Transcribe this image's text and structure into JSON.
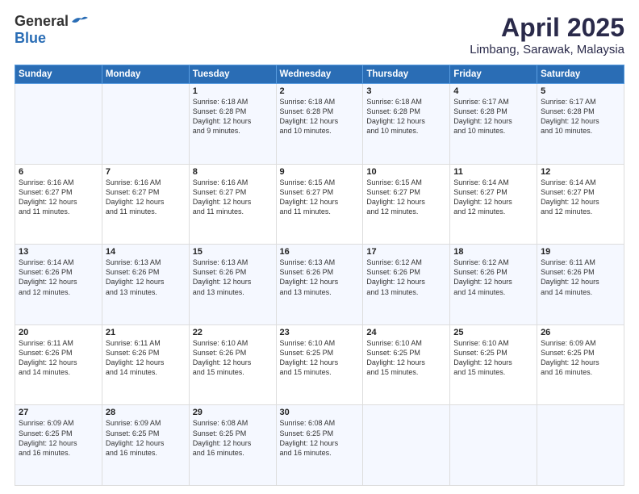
{
  "header": {
    "logo_general": "General",
    "logo_blue": "Blue",
    "month_title": "April 2025",
    "location": "Limbang, Sarawak, Malaysia"
  },
  "weekdays": [
    "Sunday",
    "Monday",
    "Tuesday",
    "Wednesday",
    "Thursday",
    "Friday",
    "Saturday"
  ],
  "weeks": [
    [
      {
        "day": "",
        "info": ""
      },
      {
        "day": "",
        "info": ""
      },
      {
        "day": "1",
        "info": "Sunrise: 6:18 AM\nSunset: 6:28 PM\nDaylight: 12 hours\nand 9 minutes."
      },
      {
        "day": "2",
        "info": "Sunrise: 6:18 AM\nSunset: 6:28 PM\nDaylight: 12 hours\nand 10 minutes."
      },
      {
        "day": "3",
        "info": "Sunrise: 6:18 AM\nSunset: 6:28 PM\nDaylight: 12 hours\nand 10 minutes."
      },
      {
        "day": "4",
        "info": "Sunrise: 6:17 AM\nSunset: 6:28 PM\nDaylight: 12 hours\nand 10 minutes."
      },
      {
        "day": "5",
        "info": "Sunrise: 6:17 AM\nSunset: 6:28 PM\nDaylight: 12 hours\nand 10 minutes."
      }
    ],
    [
      {
        "day": "6",
        "info": "Sunrise: 6:16 AM\nSunset: 6:27 PM\nDaylight: 12 hours\nand 11 minutes."
      },
      {
        "day": "7",
        "info": "Sunrise: 6:16 AM\nSunset: 6:27 PM\nDaylight: 12 hours\nand 11 minutes."
      },
      {
        "day": "8",
        "info": "Sunrise: 6:16 AM\nSunset: 6:27 PM\nDaylight: 12 hours\nand 11 minutes."
      },
      {
        "day": "9",
        "info": "Sunrise: 6:15 AM\nSunset: 6:27 PM\nDaylight: 12 hours\nand 11 minutes."
      },
      {
        "day": "10",
        "info": "Sunrise: 6:15 AM\nSunset: 6:27 PM\nDaylight: 12 hours\nand 12 minutes."
      },
      {
        "day": "11",
        "info": "Sunrise: 6:14 AM\nSunset: 6:27 PM\nDaylight: 12 hours\nand 12 minutes."
      },
      {
        "day": "12",
        "info": "Sunrise: 6:14 AM\nSunset: 6:27 PM\nDaylight: 12 hours\nand 12 minutes."
      }
    ],
    [
      {
        "day": "13",
        "info": "Sunrise: 6:14 AM\nSunset: 6:26 PM\nDaylight: 12 hours\nand 12 minutes."
      },
      {
        "day": "14",
        "info": "Sunrise: 6:13 AM\nSunset: 6:26 PM\nDaylight: 12 hours\nand 13 minutes."
      },
      {
        "day": "15",
        "info": "Sunrise: 6:13 AM\nSunset: 6:26 PM\nDaylight: 12 hours\nand 13 minutes."
      },
      {
        "day": "16",
        "info": "Sunrise: 6:13 AM\nSunset: 6:26 PM\nDaylight: 12 hours\nand 13 minutes."
      },
      {
        "day": "17",
        "info": "Sunrise: 6:12 AM\nSunset: 6:26 PM\nDaylight: 12 hours\nand 13 minutes."
      },
      {
        "day": "18",
        "info": "Sunrise: 6:12 AM\nSunset: 6:26 PM\nDaylight: 12 hours\nand 14 minutes."
      },
      {
        "day": "19",
        "info": "Sunrise: 6:11 AM\nSunset: 6:26 PM\nDaylight: 12 hours\nand 14 minutes."
      }
    ],
    [
      {
        "day": "20",
        "info": "Sunrise: 6:11 AM\nSunset: 6:26 PM\nDaylight: 12 hours\nand 14 minutes."
      },
      {
        "day": "21",
        "info": "Sunrise: 6:11 AM\nSunset: 6:26 PM\nDaylight: 12 hours\nand 14 minutes."
      },
      {
        "day": "22",
        "info": "Sunrise: 6:10 AM\nSunset: 6:26 PM\nDaylight: 12 hours\nand 15 minutes."
      },
      {
        "day": "23",
        "info": "Sunrise: 6:10 AM\nSunset: 6:25 PM\nDaylight: 12 hours\nand 15 minutes."
      },
      {
        "day": "24",
        "info": "Sunrise: 6:10 AM\nSunset: 6:25 PM\nDaylight: 12 hours\nand 15 minutes."
      },
      {
        "day": "25",
        "info": "Sunrise: 6:10 AM\nSunset: 6:25 PM\nDaylight: 12 hours\nand 15 minutes."
      },
      {
        "day": "26",
        "info": "Sunrise: 6:09 AM\nSunset: 6:25 PM\nDaylight: 12 hours\nand 16 minutes."
      }
    ],
    [
      {
        "day": "27",
        "info": "Sunrise: 6:09 AM\nSunset: 6:25 PM\nDaylight: 12 hours\nand 16 minutes."
      },
      {
        "day": "28",
        "info": "Sunrise: 6:09 AM\nSunset: 6:25 PM\nDaylight: 12 hours\nand 16 minutes."
      },
      {
        "day": "29",
        "info": "Sunrise: 6:08 AM\nSunset: 6:25 PM\nDaylight: 12 hours\nand 16 minutes."
      },
      {
        "day": "30",
        "info": "Sunrise: 6:08 AM\nSunset: 6:25 PM\nDaylight: 12 hours\nand 16 minutes."
      },
      {
        "day": "",
        "info": ""
      },
      {
        "day": "",
        "info": ""
      },
      {
        "day": "",
        "info": ""
      }
    ]
  ]
}
